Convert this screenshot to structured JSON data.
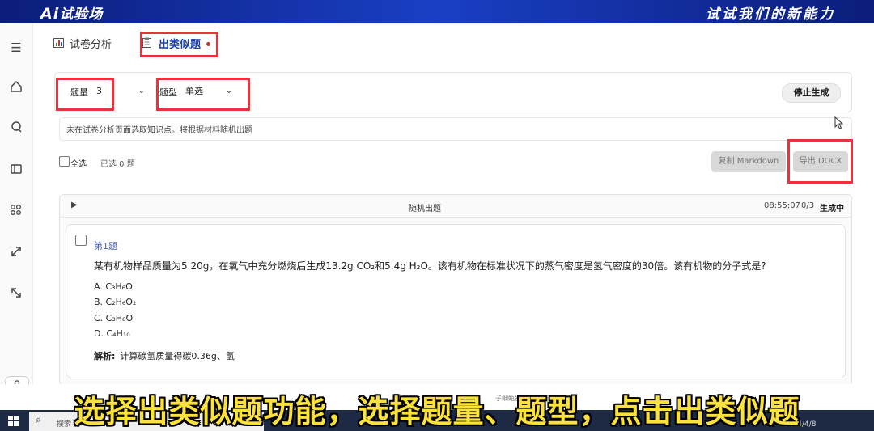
{
  "app": {
    "brand_ai": "Ai",
    "brand_name": "试验场",
    "slogan": "试试我们的新能力"
  },
  "rail": {
    "icons": [
      "menu-icon",
      "home-icon",
      "chat-icon",
      "panel-icon",
      "grid-icon",
      "expand-icon",
      "collapse-icon"
    ],
    "user_icon": "user-icon"
  },
  "tabs": [
    {
      "label": "试卷分析",
      "icon": "chart-icon"
    },
    {
      "label": "出类似题",
      "icon": "clipboard-icon",
      "active": true
    }
  ],
  "controls": {
    "quantity_label": "题量",
    "quantity_value": "3",
    "type_label": "题型",
    "type_value": "单选",
    "stop_button": "停止生成"
  },
  "notice": "未在试卷分析页面选取知识点。将根据材料随机出题",
  "selection": {
    "select_all": "全选",
    "selected_count": "已选 0 题"
  },
  "actions": {
    "copy_markdown": "复制 Markdown",
    "export_docx": "导出 DOCX"
  },
  "generation": {
    "title": "随机出题",
    "time": "08:55:07",
    "progress": "0/3",
    "status": "生成中"
  },
  "question": {
    "number": "第1题",
    "text": "某有机物样品质量为5.20g，在氧气中充分燃烧后生成13.2g CO₂和5.4g H₂O。该有机物在标准状况下的蒸气密度是氢气密度的30倍。该有机物的分子式是?",
    "options": [
      "A. C₃H₆O",
      "B. C₂H₆O₂",
      "C. C₃H₈O",
      "D. C₄H₁₀"
    ],
    "analysis_label": "解析:",
    "analysis_text": "计算碳氢质量得碳0.36g、氢"
  },
  "footer": {
    "tiny_text": "子细甄别",
    "search_text": "搜索",
    "clock": "2024/4/8"
  },
  "subtitle": "选择出类似题功能，选择题量、题型，点击出类似题",
  "colors": {
    "banner": "#1a3fc4",
    "highlight": "#e8323c",
    "subtitle": "#fbe13b"
  }
}
